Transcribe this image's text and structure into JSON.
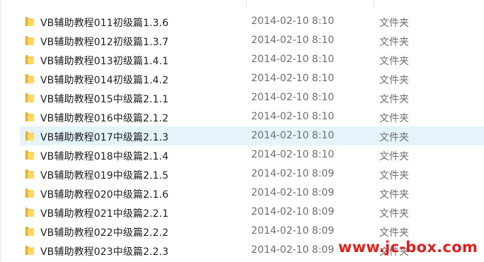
{
  "file_list": {
    "rows": [
      {
        "name": "VB辅助教程011初级篇1.3.6",
        "date": "2014-02-10 8:10",
        "type": "文件夹",
        "icon": "folder-icon",
        "selected": false
      },
      {
        "name": "VB辅助教程012初级篇1.3.7",
        "date": "2014-02-10 8:10",
        "type": "文件夹",
        "icon": "folder-icon",
        "selected": false
      },
      {
        "name": "VB辅助教程013初级篇1.4.1",
        "date": "2014-02-10 8:10",
        "type": "文件夹",
        "icon": "folder-icon",
        "selected": false
      },
      {
        "name": "VB辅助教程014初级篇1.4.2",
        "date": "2014-02-10 8:10",
        "type": "文件夹",
        "icon": "folder-icon",
        "selected": false
      },
      {
        "name": "VB辅助教程015中级篇2.1.1",
        "date": "2014-02-10 8:10",
        "type": "文件夹",
        "icon": "folder-icon",
        "selected": false
      },
      {
        "name": "VB辅助教程016中级篇2.1.2",
        "date": "2014-02-10 8:10",
        "type": "文件夹",
        "icon": "folder-icon",
        "selected": false
      },
      {
        "name": "VB辅助教程017中级篇2.1.3",
        "date": "2014-02-10 8:10",
        "type": "文件夹",
        "icon": "folder-icon",
        "selected": true
      },
      {
        "name": "VB辅助教程018中级篇2.1.4",
        "date": "2014-02-10 8:10",
        "type": "文件夹",
        "icon": "folder-icon",
        "selected": false
      },
      {
        "name": "VB辅助教程019中级篇2.1.5",
        "date": "2014-02-10 8:09",
        "type": "文件夹",
        "icon": "folder-icon",
        "selected": false
      },
      {
        "name": "VB辅助教程020中级篇2.1.6",
        "date": "2014-02-10 8:09",
        "type": "文件夹",
        "icon": "folder-icon",
        "selected": false
      },
      {
        "name": "VB辅助教程021中级篇2.2.1",
        "date": "2014-02-10 8:09",
        "type": "文件夹",
        "icon": "folder-icon",
        "selected": false
      },
      {
        "name": "VB辅助教程022中级篇2.2.2",
        "date": "2014-02-10 8:09",
        "type": "文件夹",
        "icon": "folder-icon",
        "selected": false
      },
      {
        "name": "VB辅助教程023中级篇2.2.3",
        "date": "2014-02-10 8:09",
        "type": "文件夹",
        "icon": "folder-icon",
        "selected": false
      }
    ]
  },
  "watermark": {
    "text": "www.jc-box.com"
  },
  "colors": {
    "selected_row": "#e5f3fb",
    "folder_body": "#f5c342",
    "folder_front": "#ffd865",
    "watermark": "#e0201e"
  }
}
